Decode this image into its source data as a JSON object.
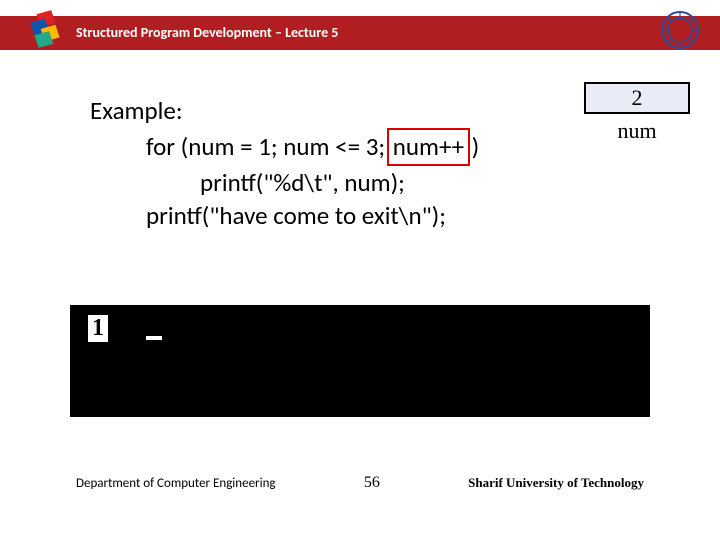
{
  "header": {
    "title": "Structured Program Development – Lecture 5"
  },
  "variable": {
    "value": "2",
    "name": "num"
  },
  "code": {
    "l1": "Example:",
    "l2a": "for (num = 1; num <= 3; ",
    "l2hl": "num++",
    "l2b": " )",
    "l3": "printf(\"%d\\t\", num);",
    "l4": "printf(\"have come to exit\\n\");"
  },
  "terminal": {
    "output1": "1",
    "cursor": "_"
  },
  "footer": {
    "department": "Department of Computer Engineering",
    "page": "56",
    "university": "Sharif University of Technology"
  }
}
